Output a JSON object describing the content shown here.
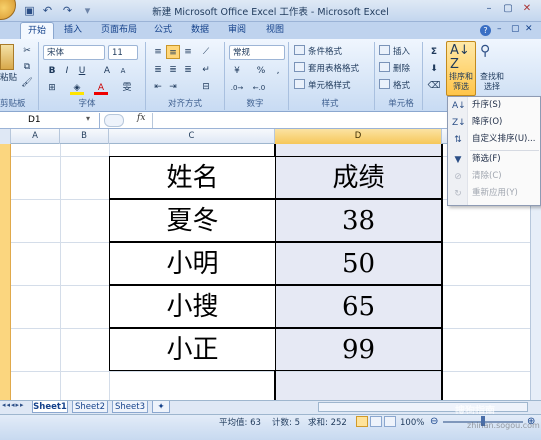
{
  "window": {
    "title": "新建 Microsoft Office Excel 工作表 - Microsoft Excel"
  },
  "qat": {
    "save_icon": "save-icon",
    "undo_icon": "undo-icon",
    "redo_icon": "redo-icon"
  },
  "tabs": [
    "开始",
    "插入",
    "页面布局",
    "公式",
    "数据",
    "审阅",
    "视图"
  ],
  "ribbon": {
    "paste_label": "粘贴",
    "font_name": "宋体",
    "font_size": "11",
    "number_format": "常规",
    "percent": "%",
    "comma": ",",
    "cond_format": "条件格式",
    "table_format": "套用表格格式",
    "cell_style": "单元格样式",
    "insert": "插入",
    "delete": "删除",
    "format": "格式",
    "sigma": "Σ",
    "sort_filter": "排序和筛选",
    "find_select": "查找和选择",
    "groups": {
      "clipboard": "剪贴板",
      "font": "字体",
      "align": "对齐方式",
      "number": "数字",
      "style": "样式",
      "cells": "单元格"
    }
  },
  "formula_bar": {
    "name_box": "D1",
    "fx": "fx",
    "value": ""
  },
  "columns": [
    "A",
    "B",
    "C",
    "D"
  ],
  "table": {
    "header": {
      "name": "姓名",
      "score": "成绩"
    },
    "rows": [
      {
        "name": "夏冬",
        "score": "38"
      },
      {
        "name": "小明",
        "score": "50"
      },
      {
        "name": "小搜",
        "score": "65"
      },
      {
        "name": "小正",
        "score": "99"
      }
    ]
  },
  "sort_menu": {
    "items": [
      {
        "label": "升序(S)",
        "enabled": true
      },
      {
        "label": "降序(O)",
        "enabled": true
      },
      {
        "label": "自定义排序(U)...",
        "enabled": true
      },
      {
        "label": "筛选(F)",
        "enabled": true
      },
      {
        "label": "清除(C)",
        "enabled": false
      },
      {
        "label": "重新应用(Y)",
        "enabled": false
      }
    ]
  },
  "sheets": [
    "Sheet1",
    "Sheet2",
    "Sheet3"
  ],
  "status": {
    "average": "平均值: 63",
    "count": "计数: 5",
    "sum": "求和: 252",
    "zoom": "100%"
  },
  "watermark": {
    "brand": "搜狗指南",
    "url": "zhinan.sogou.com"
  }
}
